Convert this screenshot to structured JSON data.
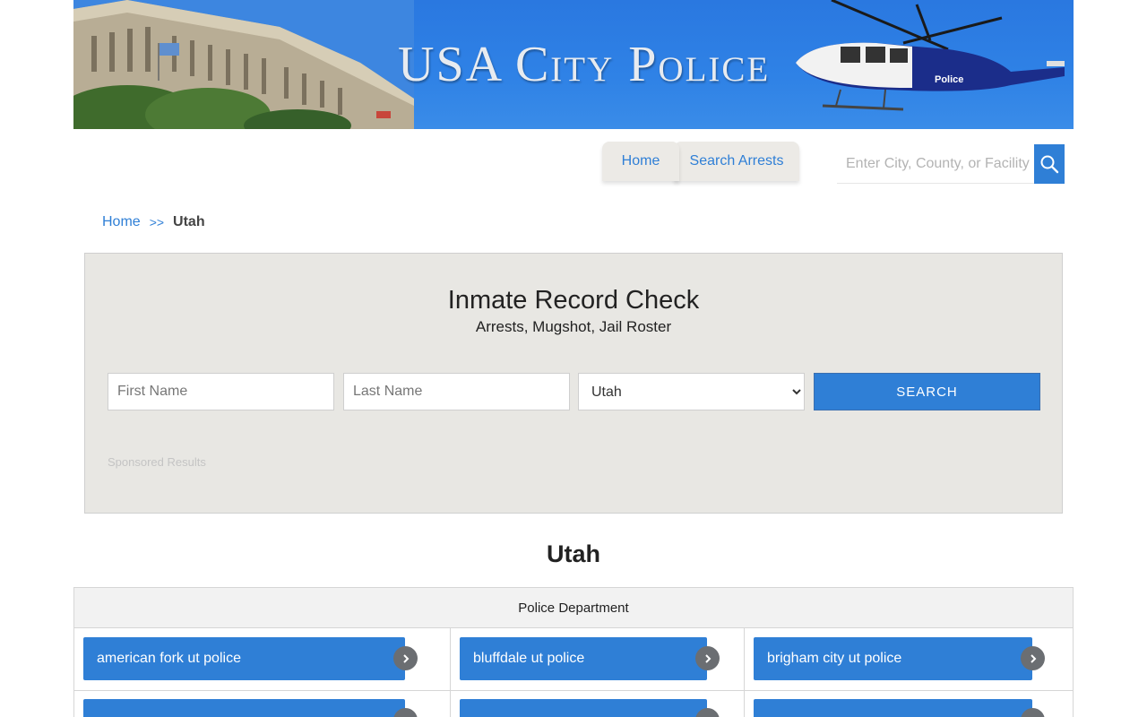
{
  "banner": {
    "title": "USA City Police",
    "helicopter_text": "Police"
  },
  "nav": {
    "tabs": [
      {
        "label": "Home"
      },
      {
        "label": "Search Arrests"
      }
    ]
  },
  "city_search": {
    "placeholder": "Enter City, County, or Facility",
    "icon": "search-icon"
  },
  "breadcrumb": {
    "home": "Home",
    "separator": ">>",
    "current": "Utah"
  },
  "record_check": {
    "title": "Inmate Record Check",
    "subtitle": "Arrests, Mugshot, Jail Roster",
    "first_name_placeholder": "First Name",
    "last_name_placeholder": "Last Name",
    "state_selected": "Utah",
    "search_label": "SEARCH",
    "sponsored": "Sponsored Results"
  },
  "state_heading": "Utah",
  "table": {
    "header": "Police Department",
    "links": [
      {
        "label": "american fork ut police"
      },
      {
        "label": "bluffdale ut police"
      },
      {
        "label": "brigham city ut police"
      }
    ]
  },
  "colors": {
    "accent": "#2f7fd6",
    "panel_bg": "#e8e7e3",
    "arrow_bg": "#6b6e72"
  }
}
